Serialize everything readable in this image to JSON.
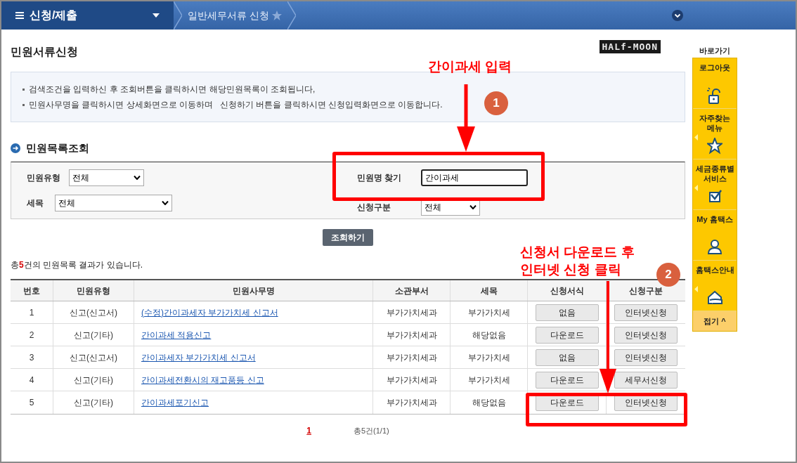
{
  "top_bar": {
    "menu_title": "신청/제출",
    "breadcrumb": "일반세무서류 신청"
  },
  "logo": "HALf-MOON",
  "page_title": "민원서류신청",
  "notices": [
    "검색조건을 입력하신 후 조회버튼을 클릭하시면 해당민원목록이 조회됩니다,",
    "민원사무명을 클릭하시면 상세화면으로 이동하며   신청하기 버튼을 클릭하시면 신청입력화면으로 이동합니다."
  ],
  "section_title": "민원목록조회",
  "filters": {
    "type_label": "민원유형",
    "type_value": "전체",
    "tax_label": "세목",
    "tax_value": "전체",
    "name_label": "민원명 찾기",
    "name_value": "간이과세",
    "apply_label": "신청구분",
    "apply_value": "전체"
  },
  "search_button": "조회하기",
  "result_summary": "총**5**건의 민원목록 결과가 있습니다.",
  "table": {
    "columns": [
      "번호",
      "민원유형",
      "민원사무명",
      "소관부서",
      "세목",
      "신청서식",
      "신청구분"
    ],
    "rows": [
      {
        "no": "1",
        "type": "신고(신고서)",
        "name": "(수정)간이과세자 부가가치세 신고서",
        "dept": "부가가치세과",
        "tax": "부가가치세",
        "form": "없음",
        "apply": "인터넷신청"
      },
      {
        "no": "2",
        "type": "신고(기타)",
        "name": "간이과세 적용신고",
        "dept": "부가가치세과",
        "tax": "해당없음",
        "form": "다운로드",
        "apply": "인터넷신청"
      },
      {
        "no": "3",
        "type": "신고(신고서)",
        "name": "간이과세자 부가가치세 신고서",
        "dept": "부가가치세과",
        "tax": "부가가치세",
        "form": "없음",
        "apply": "인터넷신청"
      },
      {
        "no": "4",
        "type": "신고(기타)",
        "name": "간이과세전환시의 재고품등 신고",
        "dept": "부가가치세과",
        "tax": "부가가치세",
        "form": "다운로드",
        "apply": "세무서신청"
      },
      {
        "no": "5",
        "type": "신고(기타)",
        "name": "간이과세포기신고",
        "dept": "부가가치세과",
        "tax": "해당없음",
        "form": "다운로드",
        "apply": "인터넷신청"
      }
    ]
  },
  "pagination": {
    "pages": [
      {
        "label": "1",
        "selected": true
      }
    ],
    "summary": "총5건(1/1)"
  },
  "sidebar": {
    "title": "바로가기",
    "items": [
      {
        "label": "로그아웃",
        "kind": "lock",
        "has_arrow": false
      },
      {
        "label": "자주찾는 메뉴",
        "kind": "star",
        "has_arrow": true
      },
      {
        "label": "세금종류별 서비스",
        "kind": "check",
        "has_arrow": true
      },
      {
        "label": "My 홈택스",
        "kind": "person",
        "has_arrow": false
      },
      {
        "label": "홈택스안내",
        "kind": "house",
        "has_arrow": true
      }
    ],
    "collapse": "접기 ^"
  },
  "annotations": [
    {
      "kind": "text",
      "text": "간이과세 입력"
    },
    {
      "kind": "circle",
      "text": "1"
    },
    {
      "kind": "text",
      "text": "신청서 다운로드 후\n인터넷 신청 클릭"
    },
    {
      "kind": "circle",
      "text": "2"
    }
  ]
}
